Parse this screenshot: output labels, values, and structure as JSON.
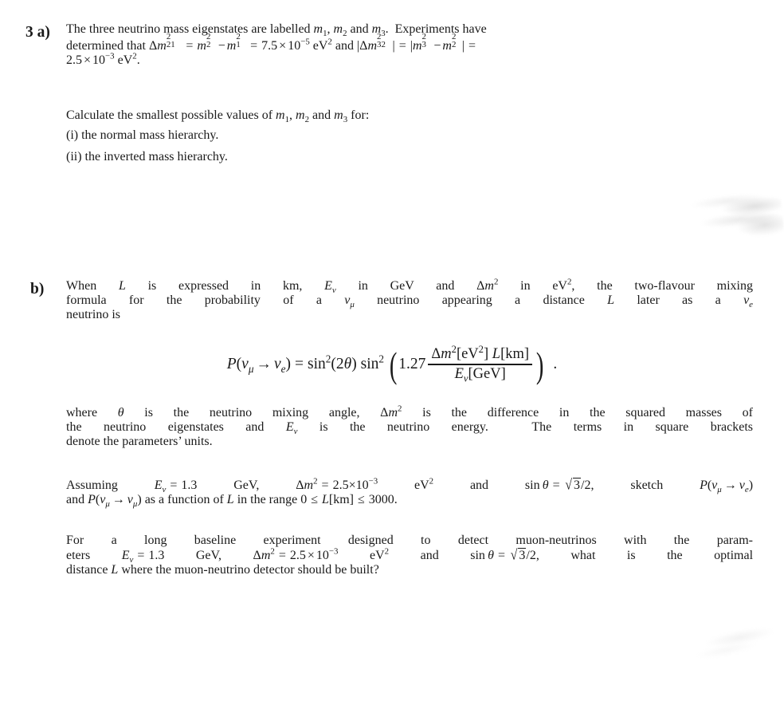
{
  "document": {
    "question_number": "3",
    "parts": [
      {
        "label": "3 a)",
        "paragraphs": [
          {
            "id": "a-intro",
            "lines": [
              "The three neutrino mass eigenstates are labelled m1, m2 and m3. Experiments have",
              "determined that Δm²₂₁ = m²₂ − m²₁ = 7.5 × 10⁻⁵ eV² and |Δm²₃₂| = |m²₃ − m²₂| =",
              "2.5 × 10⁻³ eV²."
            ]
          },
          {
            "id": "a-calculate",
            "lines": [
              "Calculate the smallest possible values of m1, m2 and m3 for:"
            ]
          }
        ],
        "subitems": [
          {
            "marker": "(i)",
            "text": "the normal mass hierarchy."
          },
          {
            "marker": "(ii)",
            "text": "the inverted mass hierarchy."
          }
        ]
      },
      {
        "label": "b)",
        "paragraphs": [
          {
            "id": "b-intro",
            "lines": [
              "When L is expressed in km, Eν in GeV and Δm² in eV², the two-flavour mixing",
              "formula for the probability of a νμ neutrino appearing a distance L later as a νe",
              "neutrino is"
            ]
          },
          {
            "id": "b-where",
            "lines": [
              "where θ is the neutrino mixing angle, Δm² is the difference in the squared masses of",
              "the neutrino eigenstates and Eν is the neutrino energy. The terms in square brackets",
              "denote the parameters’ units."
            ]
          },
          {
            "id": "b-assuming",
            "lines": [
              "Assuming Eν = 1.3 GeV, Δm² = 2.5×10⁻³ eV² and sin θ = √3/2, sketch P(νμ → νe)",
              "and P(νμ → νμ) as a function of L in the range 0 ≤ L[km] ≤ 3000."
            ]
          },
          {
            "id": "b-longbaseline",
            "lines": [
              "For a long baseline experiment designed to detect muon-neutrinos with the param-",
              "eters Eν = 1.3 GeV, Δm² = 2.5 × 10⁻³ eV² and sin θ = √3/2, what is the optimal",
              "distance L where the muon-neutrino detector should be built?"
            ]
          }
        ],
        "equation": {
          "id": "oscillation-probability",
          "latex": "P(\\nu_\\mu \\to \\nu_e) = \\sin^2(2\\theta) \\sin^2\\left(1.27 \\frac{\\Delta m^2[\\mathrm{eV}^2]\\, L[\\mathrm{km}]}{E_\\nu[\\mathrm{GeV}]}\\right).",
          "constant": "1.27",
          "numerator": "Δm²[eV²] L[km]",
          "denominator": "Eν[GeV]",
          "trailing_punctuation": "."
        }
      }
    ],
    "inline_values": {
      "delta_m21_squared": "7.5 × 10⁻⁵ eV²",
      "delta_m32_squared": "2.5 × 10⁻³ eV²",
      "neutrino_energy": "1.3 GeV",
      "delta_m_squared_assumed": "2.5×10⁻³ eV²",
      "sin_theta": "√3/2",
      "L_range_min": "0",
      "L_range_max": "3000",
      "mixing_constant": "1.27"
    },
    "colors": {
      "page_background": "#ffffff",
      "text": "#1a1a1a",
      "smudge": "#9a9a9a"
    }
  }
}
